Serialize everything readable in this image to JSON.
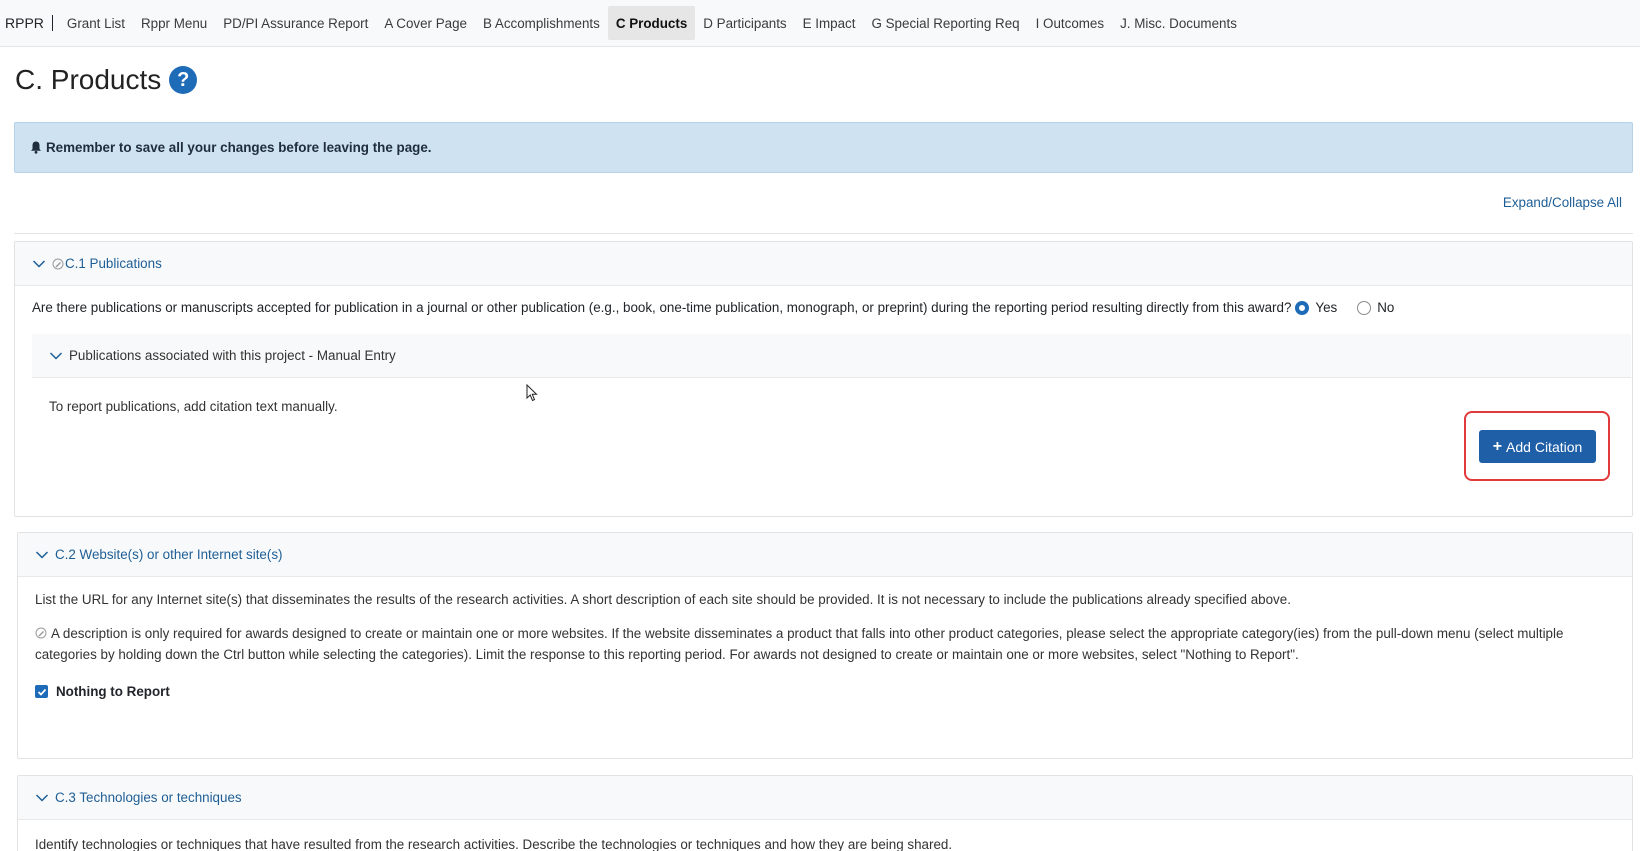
{
  "nav": {
    "brand": "RPPR",
    "items": [
      {
        "label": "Grant List",
        "active": false
      },
      {
        "label": "Rppr Menu",
        "active": false
      },
      {
        "label": "PD/PI Assurance Report",
        "active": false
      },
      {
        "label": "A Cover Page",
        "active": false
      },
      {
        "label": "B Accomplishments",
        "active": false
      },
      {
        "label": "C Products",
        "active": true
      },
      {
        "label": "D Participants",
        "active": false
      },
      {
        "label": "E Impact",
        "active": false
      },
      {
        "label": "G Special Reporting Req",
        "active": false
      },
      {
        "label": "I Outcomes",
        "active": false
      },
      {
        "label": "J. Misc. Documents",
        "active": false
      }
    ]
  },
  "page": {
    "title": "C. Products",
    "help_icon": "?",
    "alert": "Remember to save all your changes before leaving the page.",
    "expand_collapse": "Expand/Collapse All"
  },
  "c1": {
    "header": "C.1 Publications",
    "question": "Are there publications or manuscripts accepted for publication in a journal or other publication (e.g., book, one-time publication, monograph, or preprint) during the reporting period resulting directly from this award?",
    "yes_label": "Yes",
    "no_label": "No",
    "selected": "Yes",
    "subsection": "Publications associated with this project - Manual Entry",
    "instruction": "To report publications, add citation text manually.",
    "add_button": "Add Citation"
  },
  "c2": {
    "header": "C.2 Website(s) or other Internet site(s)",
    "para1": "List the URL for any Internet site(s) that disseminates the results of the research activities. A short description of each site should be provided. It is not necessary to include the publications already specified above.",
    "para2": "A description is only required for awards designed to create or maintain one or more websites. If the website disseminates a product that falls into other product categories, please select the appropriate category(ies) from the pull-down menu (select multiple categories by holding down the Ctrl button while selecting the categories). Limit the response to this reporting period. For awards not designed to create or maintain one or more websites, select \"Nothing to Report\".",
    "nothing_to_report": "Nothing to Report",
    "checked": true
  },
  "c3": {
    "header": "C.3 Technologies or techniques",
    "para1": "Identify technologies or techniques that have resulted from the research activities. Describe the technologies or techniques and how they are being shared."
  },
  "colors": {
    "primary": "#1e5fa8",
    "link": "#1e5e96",
    "alert_bg": "#cfe2f1",
    "highlight": "#e23a3a"
  }
}
